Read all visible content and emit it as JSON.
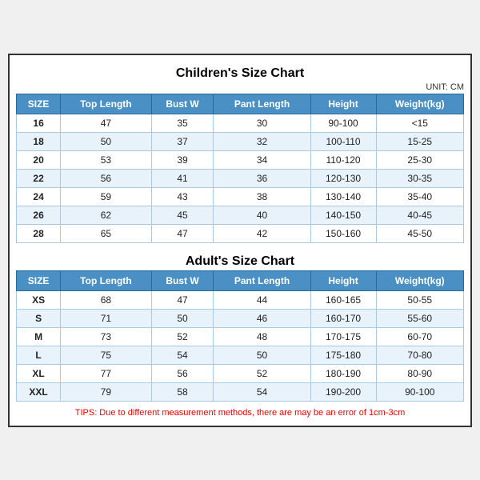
{
  "childrens": {
    "title": "Children's Size Chart",
    "unit": "UNIT: CM",
    "headers": [
      "SIZE",
      "Top Length",
      "Bust W",
      "Pant Length",
      "Height",
      "Weight(kg)"
    ],
    "rows": [
      [
        "16",
        "47",
        "35",
        "30",
        "90-100",
        "<15"
      ],
      [
        "18",
        "50",
        "37",
        "32",
        "100-110",
        "15-25"
      ],
      [
        "20",
        "53",
        "39",
        "34",
        "110-120",
        "25-30"
      ],
      [
        "22",
        "56",
        "41",
        "36",
        "120-130",
        "30-35"
      ],
      [
        "24",
        "59",
        "43",
        "38",
        "130-140",
        "35-40"
      ],
      [
        "26",
        "62",
        "45",
        "40",
        "140-150",
        "40-45"
      ],
      [
        "28",
        "65",
        "47",
        "42",
        "150-160",
        "45-50"
      ]
    ]
  },
  "adults": {
    "title": "Adult's Size Chart",
    "headers": [
      "SIZE",
      "Top Length",
      "Bust W",
      "Pant Length",
      "Height",
      "Weight(kg)"
    ],
    "rows": [
      [
        "XS",
        "68",
        "47",
        "44",
        "160-165",
        "50-55"
      ],
      [
        "S",
        "71",
        "50",
        "46",
        "160-170",
        "55-60"
      ],
      [
        "M",
        "73",
        "52",
        "48",
        "170-175",
        "60-70"
      ],
      [
        "L",
        "75",
        "54",
        "50",
        "175-180",
        "70-80"
      ],
      [
        "XL",
        "77",
        "56",
        "52",
        "180-190",
        "80-90"
      ],
      [
        "XXL",
        "79",
        "58",
        "54",
        "190-200",
        "90-100"
      ]
    ]
  },
  "tips": "TIPS: Due to different measurement methods, there are may be an error of 1cm-3cm"
}
